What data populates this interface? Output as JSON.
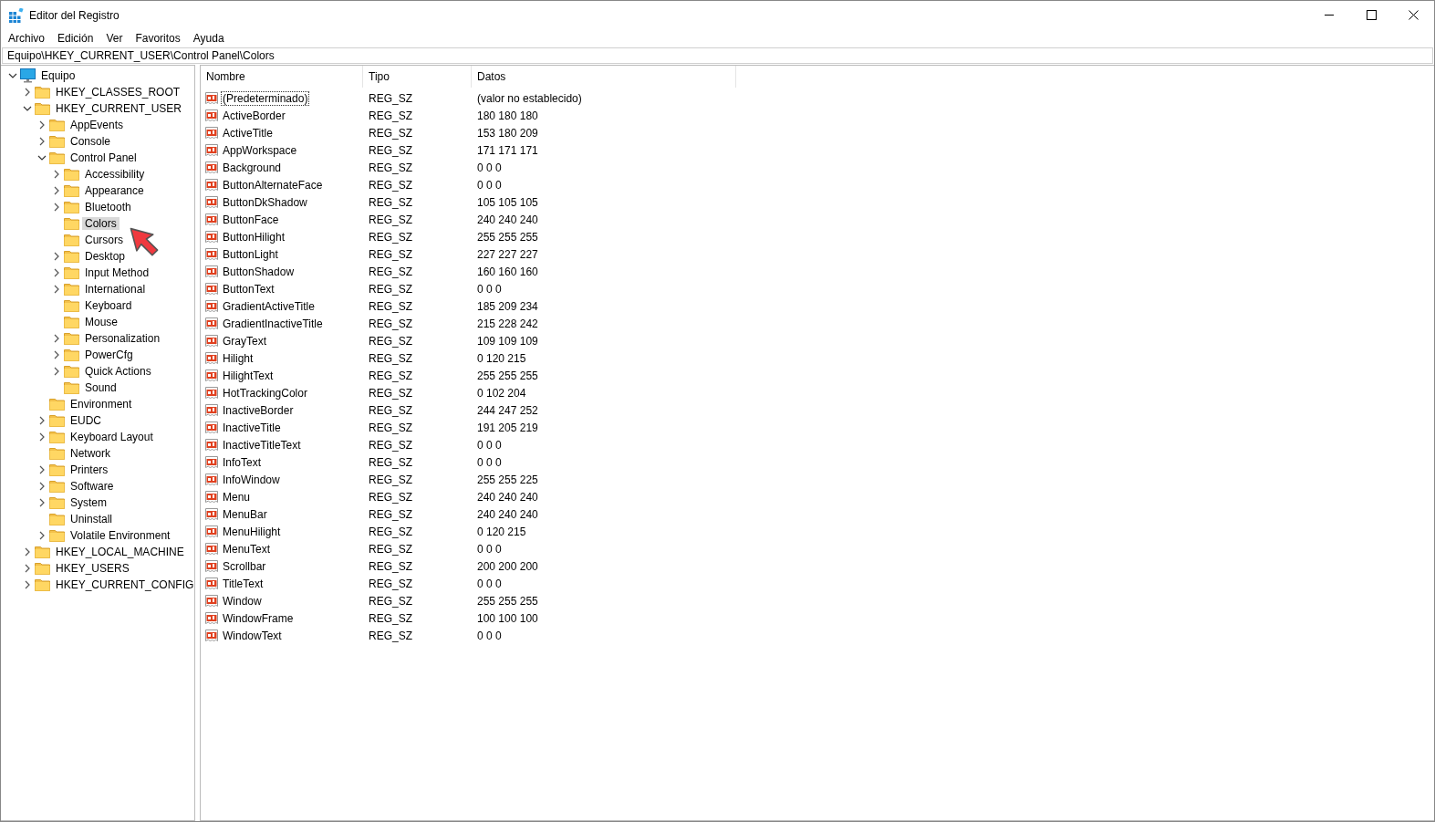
{
  "window": {
    "title": "Editor del Registro"
  },
  "menu": [
    "Archivo",
    "Edición",
    "Ver",
    "Favoritos",
    "Ayuda"
  ],
  "address": "Equipo\\HKEY_CURRENT_USER\\Control Panel\\Colors",
  "tree": [
    {
      "label": "Equipo",
      "kind": "computer",
      "expandable": true,
      "expanded": true,
      "selected": false,
      "children": [
        {
          "label": "HKEY_CLASSES_ROOT",
          "kind": "folder",
          "expandable": true,
          "expanded": false,
          "selected": false
        },
        {
          "label": "HKEY_CURRENT_USER",
          "kind": "folder",
          "expandable": true,
          "expanded": true,
          "selected": false,
          "children": [
            {
              "label": "AppEvents",
              "kind": "folder",
              "expandable": true,
              "expanded": false,
              "selected": false
            },
            {
              "label": "Console",
              "kind": "folder",
              "expandable": true,
              "expanded": false,
              "selected": false
            },
            {
              "label": "Control Panel",
              "kind": "folder",
              "expandable": true,
              "expanded": true,
              "selected": false,
              "children": [
                {
                  "label": "Accessibility",
                  "kind": "folder",
                  "expandable": true,
                  "expanded": false,
                  "selected": false
                },
                {
                  "label": "Appearance",
                  "kind": "folder",
                  "expandable": true,
                  "expanded": false,
                  "selected": false
                },
                {
                  "label": "Bluetooth",
                  "kind": "folder",
                  "expandable": true,
                  "expanded": false,
                  "selected": false
                },
                {
                  "label": "Colors",
                  "kind": "folder",
                  "expandable": false,
                  "selected": true
                },
                {
                  "label": "Cursors",
                  "kind": "folder",
                  "expandable": false,
                  "selected": false
                },
                {
                  "label": "Desktop",
                  "kind": "folder",
                  "expandable": true,
                  "expanded": false,
                  "selected": false
                },
                {
                  "label": "Input Method",
                  "kind": "folder",
                  "expandable": true,
                  "expanded": false,
                  "selected": false
                },
                {
                  "label": "International",
                  "kind": "folder",
                  "expandable": true,
                  "expanded": false,
                  "selected": false
                },
                {
                  "label": "Keyboard",
                  "kind": "folder",
                  "expandable": false,
                  "selected": false
                },
                {
                  "label": "Mouse",
                  "kind": "folder",
                  "expandable": false,
                  "selected": false
                },
                {
                  "label": "Personalization",
                  "kind": "folder",
                  "expandable": true,
                  "expanded": false,
                  "selected": false
                },
                {
                  "label": "PowerCfg",
                  "kind": "folder",
                  "expandable": true,
                  "expanded": false,
                  "selected": false
                },
                {
                  "label": "Quick Actions",
                  "kind": "folder",
                  "expandable": true,
                  "expanded": false,
                  "selected": false
                },
                {
                  "label": "Sound",
                  "kind": "folder",
                  "expandable": false,
                  "selected": false
                }
              ]
            },
            {
              "label": "Environment",
              "kind": "folder",
              "expandable": false,
              "selected": false
            },
            {
              "label": "EUDC",
              "kind": "folder",
              "expandable": true,
              "expanded": false,
              "selected": false
            },
            {
              "label": "Keyboard Layout",
              "kind": "folder",
              "expandable": true,
              "expanded": false,
              "selected": false
            },
            {
              "label": "Network",
              "kind": "folder",
              "expandable": false,
              "selected": false
            },
            {
              "label": "Printers",
              "kind": "folder",
              "expandable": true,
              "expanded": false,
              "selected": false
            },
            {
              "label": "Software",
              "kind": "folder",
              "expandable": true,
              "expanded": false,
              "selected": false
            },
            {
              "label": "System",
              "kind": "folder",
              "expandable": true,
              "expanded": false,
              "selected": false
            },
            {
              "label": "Uninstall",
              "kind": "folder",
              "expandable": false,
              "selected": false
            },
            {
              "label": "Volatile Environment",
              "kind": "folder",
              "expandable": true,
              "expanded": false,
              "selected": false
            }
          ]
        },
        {
          "label": "HKEY_LOCAL_MACHINE",
          "kind": "folder",
          "expandable": true,
          "expanded": false,
          "selected": false
        },
        {
          "label": "HKEY_USERS",
          "kind": "folder",
          "expandable": true,
          "expanded": false,
          "selected": false
        },
        {
          "label": "HKEY_CURRENT_CONFIG",
          "kind": "folder",
          "expandable": true,
          "expanded": false,
          "selected": false
        }
      ]
    }
  ],
  "table": {
    "columns": [
      "Nombre",
      "Tipo",
      "Datos"
    ],
    "rows": [
      {
        "name": "(Predeterminado)",
        "type": "REG_SZ",
        "data": "(valor no establecido)",
        "selected": true
      },
      {
        "name": "ActiveBorder",
        "type": "REG_SZ",
        "data": "180 180 180",
        "selected": false
      },
      {
        "name": "ActiveTitle",
        "type": "REG_SZ",
        "data": "153 180 209",
        "selected": false
      },
      {
        "name": "AppWorkspace",
        "type": "REG_SZ",
        "data": "171 171 171",
        "selected": false
      },
      {
        "name": "Background",
        "type": "REG_SZ",
        "data": "0 0 0",
        "selected": false
      },
      {
        "name": "ButtonAlternateFace",
        "type": "REG_SZ",
        "data": "0 0 0",
        "selected": false
      },
      {
        "name": "ButtonDkShadow",
        "type": "REG_SZ",
        "data": "105 105 105",
        "selected": false
      },
      {
        "name": "ButtonFace",
        "type": "REG_SZ",
        "data": "240 240 240",
        "selected": false
      },
      {
        "name": "ButtonHilight",
        "type": "REG_SZ",
        "data": "255 255 255",
        "selected": false
      },
      {
        "name": "ButtonLight",
        "type": "REG_SZ",
        "data": "227 227 227",
        "selected": false
      },
      {
        "name": "ButtonShadow",
        "type": "REG_SZ",
        "data": "160 160 160",
        "selected": false
      },
      {
        "name": "ButtonText",
        "type": "REG_SZ",
        "data": "0 0 0",
        "selected": false
      },
      {
        "name": "GradientActiveTitle",
        "type": "REG_SZ",
        "data": "185 209 234",
        "selected": false
      },
      {
        "name": "GradientInactiveTitle",
        "type": "REG_SZ",
        "data": "215 228 242",
        "selected": false
      },
      {
        "name": "GrayText",
        "type": "REG_SZ",
        "data": "109 109 109",
        "selected": false
      },
      {
        "name": "Hilight",
        "type": "REG_SZ",
        "data": "0 120 215",
        "selected": false
      },
      {
        "name": "HilightText",
        "type": "REG_SZ",
        "data": "255 255 255",
        "selected": false
      },
      {
        "name": "HotTrackingColor",
        "type": "REG_SZ",
        "data": "0 102 204",
        "selected": false
      },
      {
        "name": "InactiveBorder",
        "type": "REG_SZ",
        "data": "244 247 252",
        "selected": false
      },
      {
        "name": "InactiveTitle",
        "type": "REG_SZ",
        "data": "191 205 219",
        "selected": false
      },
      {
        "name": "InactiveTitleText",
        "type": "REG_SZ",
        "data": "0 0 0",
        "selected": false
      },
      {
        "name": "InfoText",
        "type": "REG_SZ",
        "data": "0 0 0",
        "selected": false
      },
      {
        "name": "InfoWindow",
        "type": "REG_SZ",
        "data": "255 255 225",
        "selected": false
      },
      {
        "name": "Menu",
        "type": "REG_SZ",
        "data": "240 240 240",
        "selected": false
      },
      {
        "name": "MenuBar",
        "type": "REG_SZ",
        "data": "240 240 240",
        "selected": false
      },
      {
        "name": "MenuHilight",
        "type": "REG_SZ",
        "data": "0 120 215",
        "selected": false
      },
      {
        "name": "MenuText",
        "type": "REG_SZ",
        "data": "0 0 0",
        "selected": false
      },
      {
        "name": "Scrollbar",
        "type": "REG_SZ",
        "data": "200 200 200",
        "selected": false
      },
      {
        "name": "TitleText",
        "type": "REG_SZ",
        "data": "0 0 0",
        "selected": false
      },
      {
        "name": "Window",
        "type": "REG_SZ",
        "data": "255 255 255",
        "selected": false
      },
      {
        "name": "WindowFrame",
        "type": "REG_SZ",
        "data": "100 100 100",
        "selected": false
      },
      {
        "name": "WindowText",
        "type": "REG_SZ",
        "data": "0 0 0",
        "selected": false
      }
    ]
  }
}
